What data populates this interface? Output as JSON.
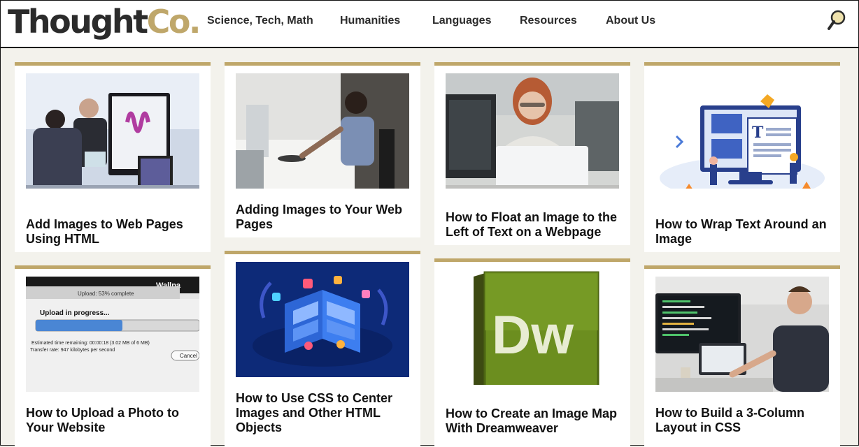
{
  "header": {
    "logo": {
      "part1": "Thought",
      "part2": "Co."
    },
    "nav": [
      "Science, Tech, Math",
      "Humanities",
      "Languages",
      "Resources",
      "About Us"
    ],
    "search_icon": "magnifier-icon"
  },
  "colors": {
    "accent": "#bfa76a",
    "background": "#f3f2ec",
    "text": "#111111"
  },
  "cards": [
    {
      "title": "Add Images to Web Pages Using HTML",
      "image": "people-at-computer-monitors-photo"
    },
    {
      "title": "Adding Images to Your Web Pages",
      "image": "woman-at-desk-computer-photo"
    },
    {
      "title": "How to Float an Image to the Left of Text on a Webpage",
      "image": "woman-at-laptop-photo"
    },
    {
      "title": "How to Wrap Text Around an Image",
      "image": "web-layout-illustration"
    },
    {
      "title": "How to Upload a Photo to Your Website",
      "image": "upload-progress-dialog-screenshot",
      "image_text": {
        "window_title": "Upload: 53% complete",
        "corner": "Wallpa",
        "heading": "Upload in progress...",
        "line1": "Estimated time remaining: 00:00:18 (3.02 MB of 6 MB)",
        "line2": "Transfer rate: 947 kilobytes per second",
        "button": "Cancel",
        "progress": 0.53
      }
    },
    {
      "title": "How to Use CSS to Center Images and Other HTML Objects",
      "image": "isometric-css-illustration"
    },
    {
      "title": "How to Create an Image Map With Dreamweaver",
      "image": "dreamweaver-logo",
      "image_text": {
        "logo": "Dw"
      }
    },
    {
      "title": "How to Build a 3-Column Layout in CSS",
      "image": "developer-coding-photo"
    }
  ]
}
